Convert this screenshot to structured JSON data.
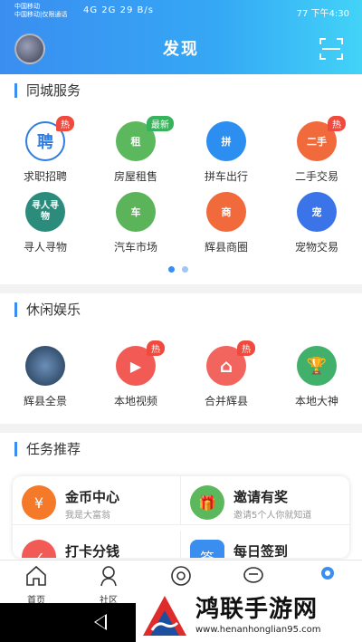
{
  "status_bar": {
    "carrier1": "中国移动",
    "carrier2": "中国移动|仅限通话",
    "signal": "4G 2G",
    "speed": "29 B/s",
    "time": "下午4:30",
    "battery": "77"
  },
  "header": {
    "title": "发现"
  },
  "section_city": {
    "title": "同城服务",
    "items": [
      {
        "label": "求职招聘",
        "icon_text": "聘",
        "color": "#2f7de0",
        "badge": "热"
      },
      {
        "label": "房屋租售",
        "icon_text": "租",
        "color": "#5cb85c",
        "badge": "最新"
      },
      {
        "label": "拼车出行",
        "icon_text": "拼",
        "color": "#2b8ef0",
        "badge": ""
      },
      {
        "label": "二手交易",
        "icon_text": "二手",
        "color": "#f06a3c",
        "badge": "热"
      },
      {
        "label": "寻人寻物",
        "icon_text": "寻人寻物",
        "color": "#2c8c7c",
        "badge": ""
      },
      {
        "label": "汽车市场",
        "icon_text": "车",
        "color": "#5bb45a",
        "badge": ""
      },
      {
        "label": "辉县商圈",
        "icon_text": "商",
        "color": "#f06a3c",
        "badge": ""
      },
      {
        "label": "宠物交易",
        "icon_text": "宠",
        "color": "#3a74e8",
        "badge": ""
      }
    ]
  },
  "section_fun": {
    "title": "休闲娱乐",
    "items": [
      {
        "label": "辉县全景",
        "icon_text": "",
        "color": "#3b5b85",
        "badge": ""
      },
      {
        "label": "本地视频",
        "icon_text": "▶",
        "color": "#f25a55",
        "badge": "热"
      },
      {
        "label": "合并辉县",
        "icon_text": "⌂",
        "color": "#f2645e",
        "badge": "热"
      },
      {
        "label": "本地大神",
        "icon_text": "🏆",
        "color": "#40b06a",
        "badge": ""
      }
    ]
  },
  "section_tasks": {
    "title": "任务推荐",
    "items": [
      {
        "title": "金币中心",
        "sub": "我是大富翁",
        "icon": "¥",
        "color": "#f47a2a"
      },
      {
        "title": "邀请有奖",
        "sub": "邀请5个人你就知道",
        "icon": "🎁",
        "color": "#5cb85c"
      },
      {
        "title": "打卡分钱",
        "sub": "",
        "icon": "✓",
        "color": "#f25a55"
      },
      {
        "title": "每日签到",
        "sub": "",
        "icon": "签",
        "color": "#3a8ef0"
      }
    ]
  },
  "tabbar": {
    "tabs": [
      {
        "label": "首页"
      },
      {
        "label": "社区"
      },
      {
        "label": ""
      },
      {
        "label": ""
      },
      {
        "label": ""
      }
    ]
  },
  "watermark": {
    "text": "鸿联手游网",
    "url": "www.henanhonglian95.com"
  }
}
